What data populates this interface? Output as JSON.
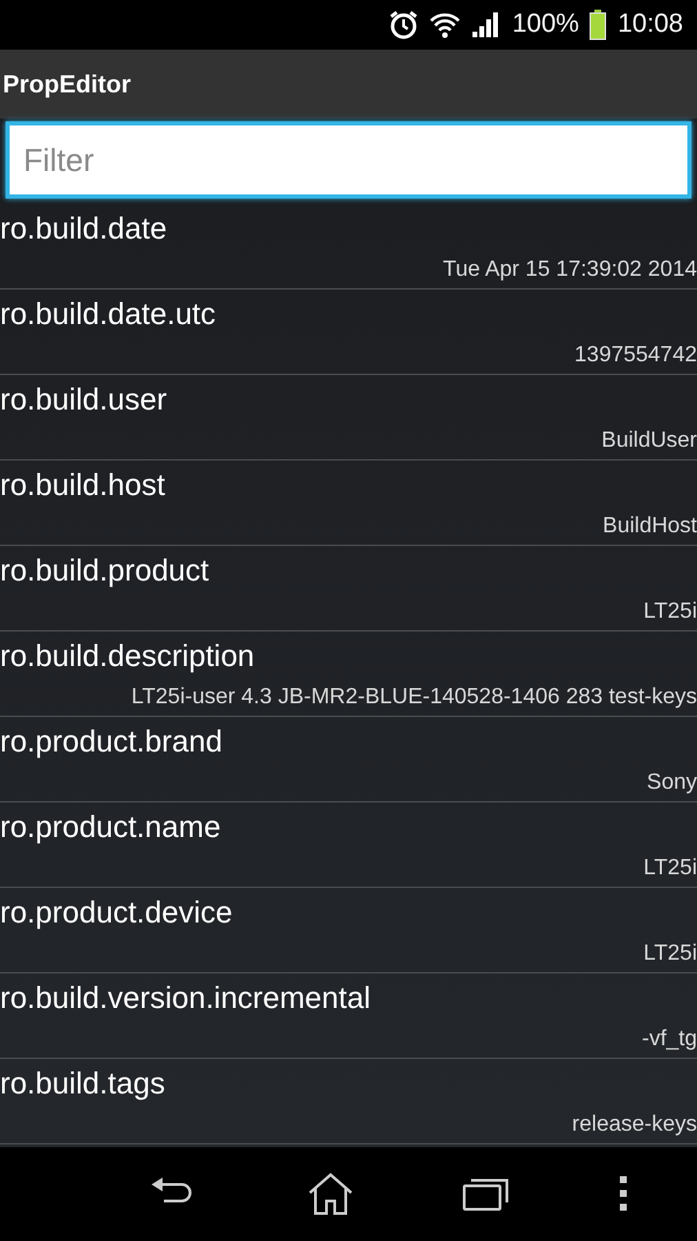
{
  "status_bar": {
    "battery": "100%",
    "time": "10:08"
  },
  "action_bar": {
    "title": "PropEditor"
  },
  "filter": {
    "placeholder": "Filter"
  },
  "properties": [
    {
      "name": "ro.build.date",
      "value": "Tue Apr 15 17:39:02 2014"
    },
    {
      "name": "ro.build.date.utc",
      "value": "1397554742"
    },
    {
      "name": "ro.build.user",
      "value": "BuildUser"
    },
    {
      "name": "ro.build.host",
      "value": "BuildHost"
    },
    {
      "name": "ro.build.product",
      "value": "LT25i"
    },
    {
      "name": "ro.build.description",
      "value": "LT25i-user 4.3 JB-MR2-BLUE-140528-1406 283 test-keys"
    },
    {
      "name": "ro.product.brand",
      "value": "Sony"
    },
    {
      "name": "ro.product.name",
      "value": "LT25i"
    },
    {
      "name": "ro.product.device",
      "value": "LT25i"
    },
    {
      "name": "ro.build.version.incremental",
      "value": "-vf_tg"
    },
    {
      "name": "ro.build.tags",
      "value": "release-keys"
    }
  ]
}
